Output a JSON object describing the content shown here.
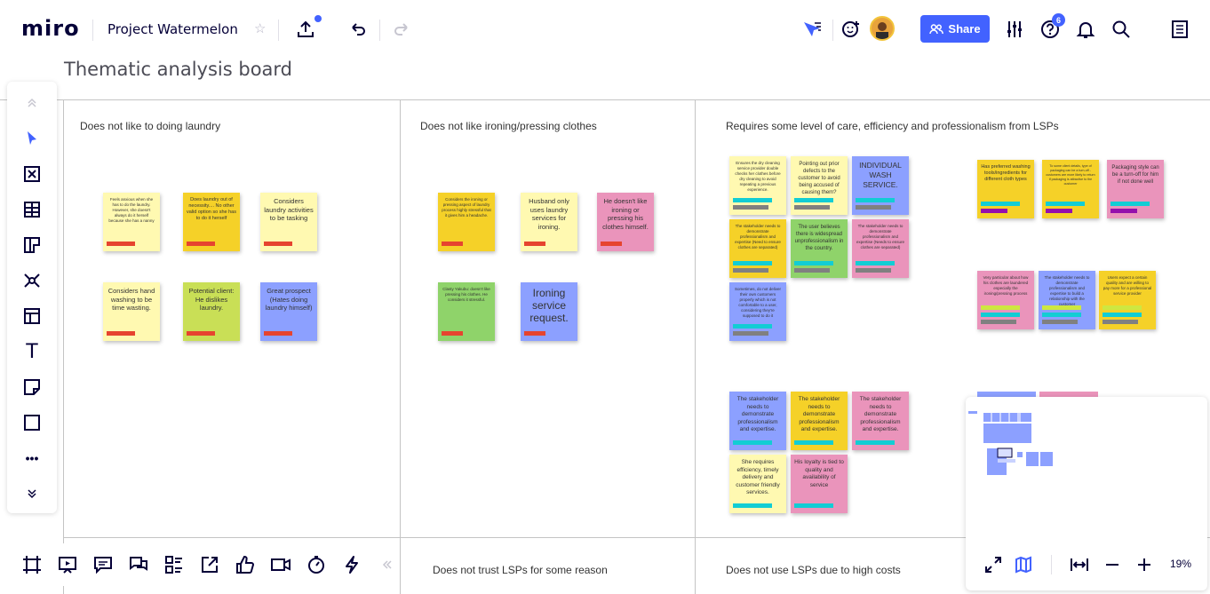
{
  "app": {
    "logo": "miro"
  },
  "header": {
    "project_title": "Project Watermelon",
    "share_label": "Share",
    "notification_count": "6"
  },
  "board": {
    "title": "Thematic analysis board",
    "columns": [
      "Does not like to doing laundry",
      "Does not like ironing/pressing clothes",
      "Requires some level of care, efficiency and professionalism from LSPs"
    ],
    "bottom_columns": [
      "Does not trust LSPs for some reason",
      "Does not use LSPs due to high costs"
    ],
    "stickies": {
      "c1_1": "Feels anxious when she has to do the laundry. However, she doesn't always do it herself because she has a nanny",
      "c1_2": "Does laundry out of necessity.... No other valid option so she has to do it herself",
      "c1_3": "Considers laundry activities to be tasking",
      "c1_4": "Considers hand washing to be time wasting.",
      "c1_5": "Potential client: He dislikes laundry.",
      "c1_6": "Great prospect (Hates doing laundry himself)",
      "c2_1": "Considers the ironing or pressing aspect of laundry process highly stressful that it gives him a headache.",
      "c2_2": "Husband only uses laundry services for ironing.",
      "c2_3": "He doesn't like ironing or pressing his clothes himself.",
      "c2_4": "Clasty Yakubu: doesn't like pressing his clothes. He considers it stressful.",
      "c2_5": "Ironing service request.",
      "c3_1": "Ensures the dry cleaning service provider double checks her clothes before dry cleaning to avoid repeating a previous experience.",
      "c3_2": "Pointing out prior defects to the customer to avoid being accused of causing them?",
      "c3_3": "INDIVIDUAL WASH SERVICE.",
      "c3_4": "The stakeholder needs to demonstrate professionalism and expertise (Need to ensure clothes are separated)",
      "c3_5": "The user believes there is widespread unprofessionalism in the country.",
      "c3_6": "The stakeholder needs to demonstrate professionalism and expertise (Needs to ensure clothes are separated)",
      "c3_7": "Sometimes, do not deliver their own customers properly which is not comfortable to a user, considering they're supposed to do it",
      "c3_8": "The stakeholder needs to demonstrate professionalism and expertise.",
      "c3_9": "The stakeholder needs to demonstrate professionalism and expertise.",
      "c3_10": "The stakeholder needs to demonstrate professionalism and expertise.",
      "c3_11": "She requires efficiency, timely delivery and customer friendly services.",
      "c3_12": "His loyalty is tied to quality and availability of service",
      "c3_13": "Has preferred washing tools/ingredients for different cloth types",
      "c3_14": "To some client details, type of packaging can be a turn-off - customers are more likely to return if packaging is attractive to the customer",
      "c3_15": "Packaging style can be a turn-off for him if not done well",
      "c3_16": "Very particular about how his clothes are laundered especially the ironing/pressing process",
      "c3_17": "The stakeholder needs to demonstrate professionalism and expertise to build a relationship with the customer",
      "c3_18": "Users expect a certain quality and are willing to pay more for a professional service provider"
    }
  },
  "toolbar": {
    "icons": [
      "collapse-up-icon",
      "select-cursor-icon",
      "frame-x-icon",
      "table-icon",
      "kanban-icon",
      "mindmap-icon",
      "templates-icon",
      "text-icon",
      "sticky-note-icon",
      "shape-icon",
      "more-icon",
      "expand-down-icon"
    ],
    "text_tool": "T",
    "more_tool": "•••"
  },
  "bottom_toolbar": {
    "icons": [
      "frames-icon",
      "presentation-icon",
      "comments-icon",
      "chat-icon",
      "cards-icon",
      "share-screen-icon",
      "voting-icon",
      "video-icon",
      "timer-icon",
      "lightning-icon",
      "collapse-left-icon"
    ]
  },
  "minimap": {
    "zoom": "19%"
  },
  "colors": {
    "accent": "#4262ff",
    "yellow": "#fff9b1",
    "orange": "#f5d128",
    "green": "#d5f692",
    "pink": "#ea94bb",
    "blue": "#8ca0ff",
    "tag_red": "#e6442f",
    "tag_cyan": "#12cdd4",
    "tag_purple": "#9510ac",
    "tag_gray": "#808080",
    "tag_lime": "#cee741"
  }
}
